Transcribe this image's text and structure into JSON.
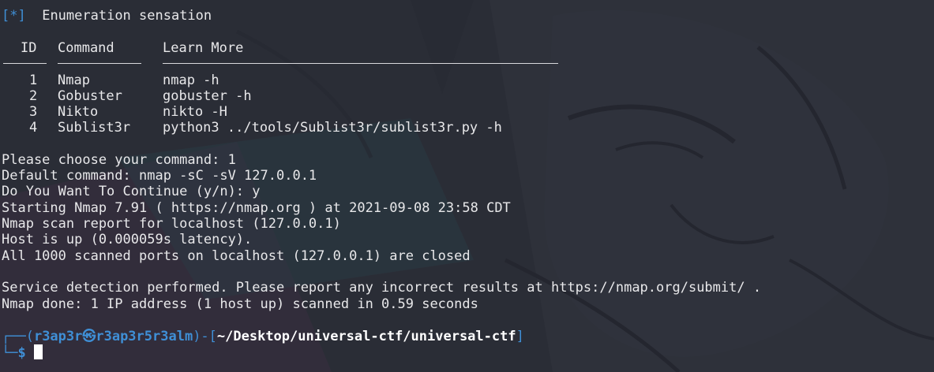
{
  "banner": {
    "marker": "[*]",
    "text": "Enumeration sensation"
  },
  "table": {
    "headers": {
      "id": "ID",
      "command": "Command",
      "learn_more": "Learn More"
    },
    "rows": [
      {
        "id": "1",
        "command": "Nmap",
        "learn_more": "nmap -h"
      },
      {
        "id": "2",
        "command": "Gobuster",
        "learn_more": "gobuster -h"
      },
      {
        "id": "3",
        "command": "Nikto",
        "learn_more": "nikto -H"
      },
      {
        "id": "4",
        "command": "Sublist3r",
        "learn_more": "python3 ../tools/Sublist3r/sublist3r.py -h"
      }
    ]
  },
  "output": {
    "choose": "Please choose your command: 1",
    "default_cmd": "Default command: nmap -sC -sV 127.0.0.1",
    "continue": "Do You Want To Continue (y/n): y",
    "starting": "Starting Nmap 7.91 ( https://nmap.org ) at 2021-09-08 23:58 CDT",
    "report": "Nmap scan report for localhost (127.0.0.1)",
    "host_up": "Host is up (0.000059s latency).",
    "ports": "All 1000 scanned ports on localhost (127.0.0.1) are closed",
    "service": "Service detection performed. Please report any incorrect results at https://nmap.org/submit/ .",
    "done": "Nmap done: 1 IP address (1 host up) scanned in 0.59 seconds"
  },
  "prompt": {
    "top_left": "┌──(",
    "user_host": "r3ap3r㉿r3ap3r5r3alm",
    "mid": ")-[",
    "path": "~/Desktop/universal-ctf/universal-ctf",
    "close": "]",
    "bottom_left": "└─",
    "symbol": "$"
  },
  "colors": {
    "accent_blue": "#3f8fd6",
    "text": "#e8e8ea",
    "background": "#2b2e36"
  }
}
